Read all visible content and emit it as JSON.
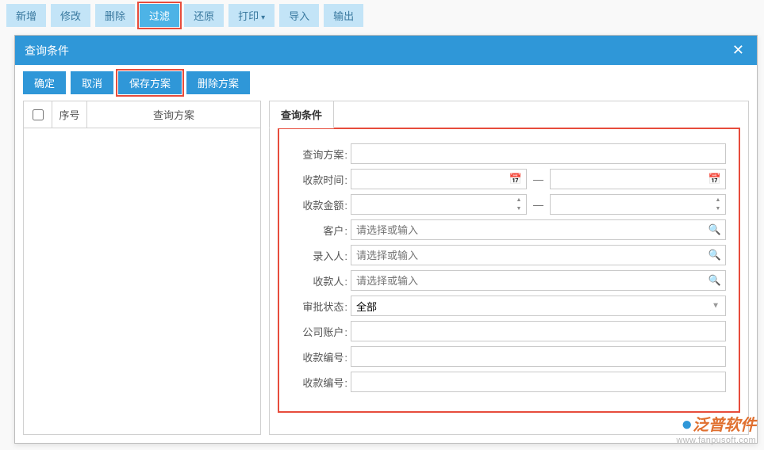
{
  "toolbar": {
    "add": "新增",
    "edit": "修改",
    "delete": "删除",
    "filter": "过滤",
    "restore": "还原",
    "print": "打印",
    "import": "导入",
    "export": "输出"
  },
  "dialog": {
    "title": "查询条件",
    "ok": "确定",
    "cancel": "取消",
    "save_scheme": "保存方案",
    "delete_scheme": "删除方案"
  },
  "grid": {
    "seq_header": "序号",
    "scheme_header": "查询方案"
  },
  "tab": {
    "conditions": "查询条件"
  },
  "form": {
    "query_scheme": {
      "label": "查询方案",
      "value": ""
    },
    "receive_time": {
      "label": "收款时间",
      "from": "",
      "to": "",
      "sep": "—"
    },
    "receive_amount": {
      "label": "收款金额",
      "from": "",
      "to": "",
      "sep": "—"
    },
    "customer": {
      "label": "客户",
      "placeholder": "请选择或输入",
      "value": ""
    },
    "entry_person": {
      "label": "录入人",
      "placeholder": "请选择或输入",
      "value": ""
    },
    "payee": {
      "label": "收款人",
      "placeholder": "请选择或输入",
      "value": ""
    },
    "approval_status": {
      "label": "审批状态",
      "value": "全部"
    },
    "company_account": {
      "label": "公司账户",
      "value": ""
    },
    "receipt_no_1": {
      "label": "收款编号",
      "value": ""
    },
    "receipt_no_2": {
      "label": "收款编号",
      "value": ""
    }
  },
  "watermark": {
    "brand": "泛普软件",
    "url": "www.fanpusoft.com"
  }
}
